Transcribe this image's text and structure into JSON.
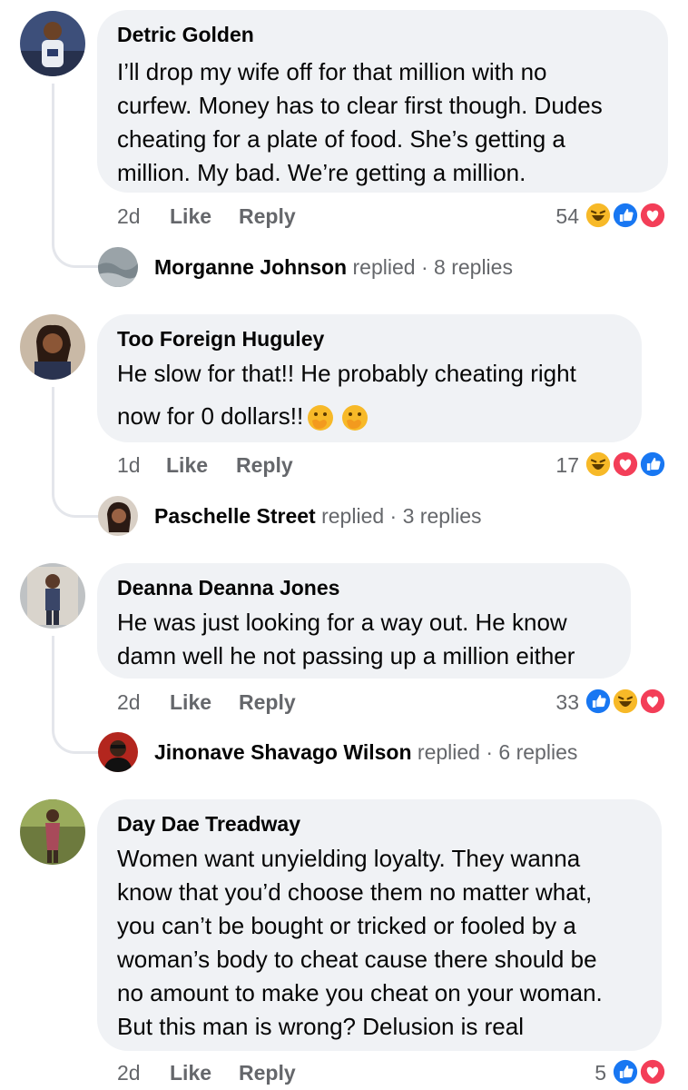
{
  "comments": [
    {
      "author": "Detric Golden",
      "lines": [
        "I’ll drop my wife off for that million with no",
        "curfew. Money has to clear first though. Dudes",
        "cheating for a plate of food. She’s getting a",
        "million. My bad. We’re getting a million."
      ],
      "age": "2d",
      "like": "Like",
      "reply": "Reply",
      "reaction_count": "54",
      "reactions": [
        "haha",
        "like",
        "love"
      ],
      "reply_author": "Morganne Johnson",
      "replied_word": "replied",
      "reply_count": "8 replies"
    },
    {
      "author": "Too Foreign Huguley",
      "lines": [
        "He slow for that!! He probably cheating right",
        "now for 0 dollars!!"
      ],
      "emojis": [
        "face-with-hand-over-mouth",
        "face-with-hand-over-mouth"
      ],
      "age": "1d",
      "like": "Like",
      "reply": "Reply",
      "reaction_count": "17",
      "reactions": [
        "haha",
        "love",
        "like"
      ],
      "reply_author": "Paschelle Street",
      "replied_word": "replied",
      "reply_count": "3 replies"
    },
    {
      "author": "Deanna Deanna Jones",
      "lines": [
        "He was just looking for a way out. He know",
        "damn well he not passing up a million either"
      ],
      "age": "2d",
      "like": "Like",
      "reply": "Reply",
      "reaction_count": "33",
      "reactions": [
        "like",
        "haha",
        "love"
      ],
      "reply_author": "Jinonave Shavago Wilson",
      "replied_word": "replied",
      "reply_count": "6 replies"
    },
    {
      "author": "Day Dae Treadway",
      "lines": [
        "Women want unyielding loyalty. They wanna",
        "know that you’d choose them no matter what,",
        "you can’t be bought or tricked or fooled by a",
        "woman’s body to cheat cause there should be",
        "no amount to make you cheat on your woman.",
        "But this man is wrong? Delusion is real"
      ],
      "age": "2d",
      "like": "Like",
      "reply": "Reply",
      "reaction_count": "5",
      "reactions": [
        "like",
        "love"
      ]
    }
  ],
  "separator": "·",
  "colors": {
    "bubble": "#f0f2f5",
    "meta_text": "#65676b",
    "like_blue": "#1877f2",
    "love_red": "#f33e58",
    "haha_yellow": "#f7b928"
  }
}
